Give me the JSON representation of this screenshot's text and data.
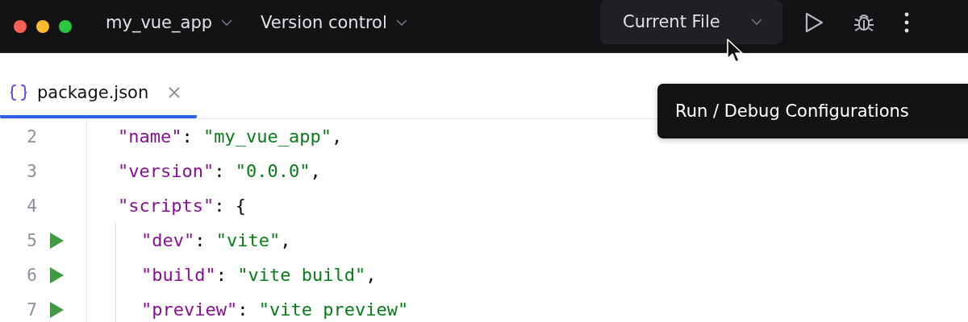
{
  "title_bar": {
    "project": "my_vue_app",
    "vcs": "Version control",
    "run_config": "Current File"
  },
  "tabs": [
    {
      "label": "package.json",
      "selected": true
    }
  ],
  "editor": {
    "lines": [
      {
        "number": "2",
        "run_marker": false,
        "tokens": [
          {
            "kind": "key",
            "text": "\"name\""
          },
          {
            "kind": "punct",
            "text": ": "
          },
          {
            "kind": "string",
            "text": "\"my_vue_app\""
          },
          {
            "kind": "punct",
            "text": ","
          }
        ]
      },
      {
        "number": "3",
        "run_marker": false,
        "tokens": [
          {
            "kind": "key",
            "text": "\"version\""
          },
          {
            "kind": "punct",
            "text": ": "
          },
          {
            "kind": "string",
            "text": "\"0.0.0\""
          },
          {
            "kind": "punct",
            "text": ","
          }
        ]
      },
      {
        "number": "4",
        "run_marker": false,
        "tokens": [
          {
            "kind": "key",
            "text": "\"scripts\""
          },
          {
            "kind": "punct",
            "text": ": {"
          }
        ],
        "children": [
          {
            "number": "5",
            "run_marker": true,
            "tokens": [
              {
                "kind": "key",
                "text": "\"dev\""
              },
              {
                "kind": "punct",
                "text": ": "
              },
              {
                "kind": "string",
                "text": "\"vite\""
              },
              {
                "kind": "punct",
                "text": ","
              }
            ]
          },
          {
            "number": "6",
            "run_marker": true,
            "tokens": [
              {
                "kind": "key",
                "text": "\"build\""
              },
              {
                "kind": "punct",
                "text": ": "
              },
              {
                "kind": "string",
                "text": "\"vite build\""
              },
              {
                "kind": "punct",
                "text": ","
              }
            ]
          },
          {
            "number": "7",
            "run_marker": true,
            "tokens": [
              {
                "kind": "key",
                "text": "\"preview\""
              },
              {
                "kind": "punct",
                "text": ": "
              },
              {
                "kind": "string",
                "text": "\"vite preview\""
              }
            ]
          }
        ]
      }
    ]
  },
  "tooltip": {
    "text": "Run / Debug Configurations"
  }
}
